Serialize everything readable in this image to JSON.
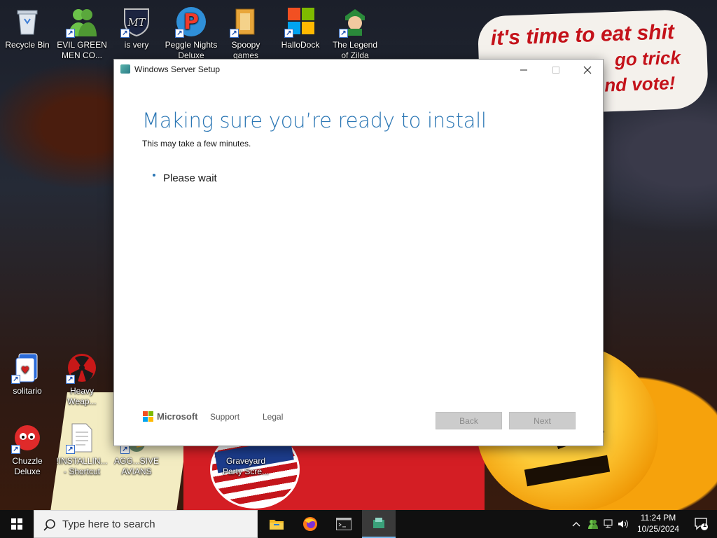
{
  "desktop": {
    "wallpaper_text": [
      "it's time to eat shit",
      "go trick",
      "nd vote!"
    ],
    "icons_top": [
      {
        "name": "recycle-bin",
        "label": "Recycle Bin"
      },
      {
        "name": "evil-green-men",
        "label": "EVIL GREEN\nMEN CO..."
      },
      {
        "name": "is-very",
        "label": "is very"
      },
      {
        "name": "peggle-nights",
        "label": "Peggle Nights\nDeluxe"
      },
      {
        "name": "spoopy-games",
        "label": "Spoopy\ngames"
      },
      {
        "name": "hallodock",
        "label": "HalloDock"
      },
      {
        "name": "legend-of-zilda",
        "label": "The Legend\nof Zilda"
      }
    ],
    "icons_bottom": [
      {
        "name": "solitario",
        "label": "solitario"
      },
      {
        "name": "heavy-weapon",
        "label": "Heavy\nWeap..."
      },
      {
        "name": "chuzzle-deluxe",
        "label": "Chuzzle\nDeluxe"
      },
      {
        "name": "installin-shortcut",
        "label": "!INSTALLIN...\n- Shortcut"
      },
      {
        "name": "aggressive-avians",
        "label": "AGG...SIVE\nAVIANS"
      },
      {
        "name": "graveyard-party",
        "label": "Graveyard\nParty Scre..."
      }
    ]
  },
  "window": {
    "title": "Windows Server Setup",
    "heading": "Making sure you’re ready to install",
    "subtext": "This may take a few minutes.",
    "status": "Please wait",
    "brand": "Microsoft",
    "links": {
      "support": "Support",
      "legal": "Legal"
    },
    "buttons": {
      "back": "Back",
      "next": "Next"
    },
    "controls": {
      "minimize": "—",
      "maximize": "☐",
      "close": "✕"
    }
  },
  "taskbar": {
    "search_placeholder": "Type here to search",
    "apps": [
      "file-explorer",
      "firefox",
      "terminal",
      "windows-server-setup"
    ],
    "time": "11:24 PM",
    "date": "10/25/2024",
    "notification_count": "1"
  },
  "colors": {
    "accent": "#2a76b4",
    "taskbar": "#101010",
    "disabled_button": "#cccccc"
  }
}
